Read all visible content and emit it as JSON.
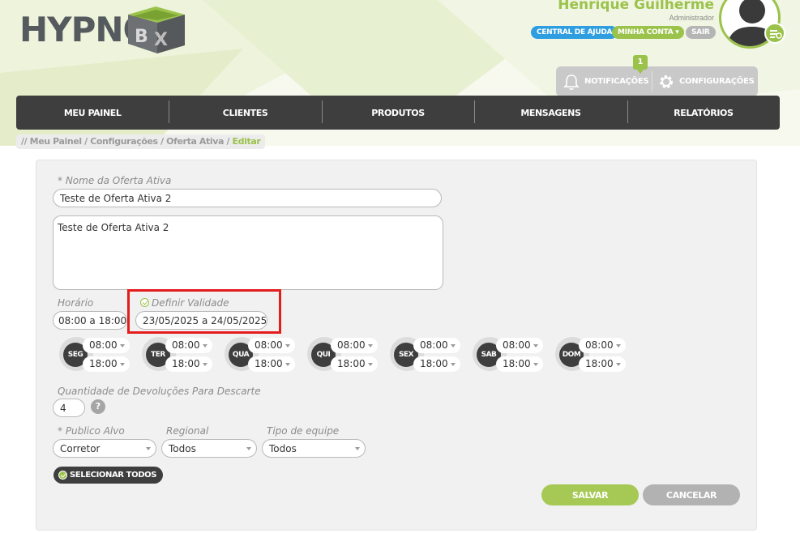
{
  "brand": {
    "logo_text": "HYPNO",
    "logo_box_text": "BOX",
    "accent_color": "#9bc24b",
    "dark_color": "#3e3e3e"
  },
  "user": {
    "name": "Henrique Guilherme",
    "role": "Administrador"
  },
  "header_links": {
    "help": "CENTRAL DE AJUDA",
    "account": "MINHA CONTA",
    "exit": "SAIR"
  },
  "notifications": {
    "label": "NOTIFICAÇÕES",
    "count": "1",
    "settings_label": "CONFIGURAÇÕES"
  },
  "nav": {
    "items": [
      "MEU PAINEL",
      "CLIENTES",
      "PRODUTOS",
      "MENSAGENS",
      "RELATÓRIOS"
    ]
  },
  "breadcrumb": {
    "prefix": "// Meu Painel / Configurações / Oferta Ativa / ",
    "current": "Editar"
  },
  "form": {
    "name_label": "* Nome da Oferta Ativa",
    "name_value": "Teste de Oferta Ativa 2",
    "description_value": "Teste de Oferta Ativa 2",
    "horario_label": "Horário",
    "horario_value": "08:00  a  18:00",
    "validade_label": "Definir Validade",
    "validade_checked": true,
    "validade_value": "23/05/2025  a  24/05/2025",
    "days": [
      {
        "label": "SEG",
        "start": "08:00",
        "end": "18:00"
      },
      {
        "label": "TER",
        "start": "08:00",
        "end": "18:00"
      },
      {
        "label": "QUA",
        "start": "08:00",
        "end": "18:00"
      },
      {
        "label": "QUI",
        "start": "08:00",
        "end": "18:00"
      },
      {
        "label": "SEX",
        "start": "08:00",
        "end": "18:00"
      },
      {
        "label": "SAB",
        "start": "08:00",
        "end": "18:00"
      },
      {
        "label": "DOM",
        "start": "08:00",
        "end": "18:00"
      }
    ],
    "devolucoes_label": "Quantidade de Devoluções Para Descarte",
    "devolucoes_value": "4",
    "help_glyph": "?",
    "publico_label": "* Publico Alvo",
    "publico_value": "Corretor",
    "regional_label": "Regional",
    "regional_value": "Todos",
    "equipe_label": "Tipo de equipe",
    "equipe_value": "Todos",
    "select_all_label": "SELECIONAR TODOS",
    "save_label": "SALVAR",
    "cancel_label": "CANCELAR"
  }
}
